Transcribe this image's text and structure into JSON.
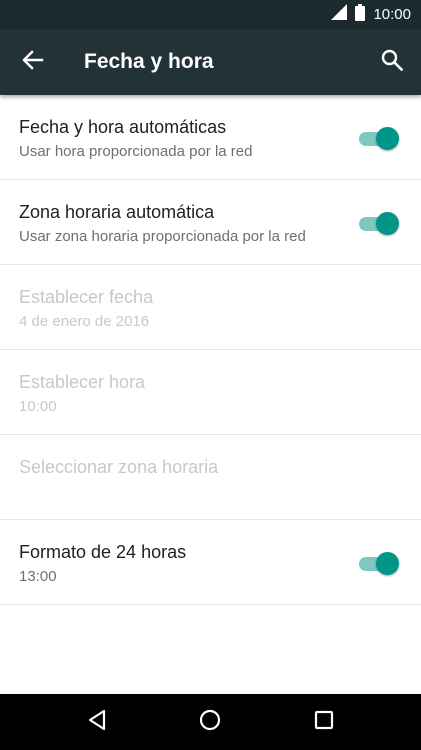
{
  "status_bar": {
    "time": "10:00",
    "icons": [
      "signal-icon",
      "battery-icon"
    ]
  },
  "app_bar": {
    "title": "Fecha y hora",
    "back_icon": "arrow-back-icon",
    "search_icon": "search-icon"
  },
  "settings": [
    {
      "title": "Fecha y hora automáticas",
      "subtitle": "Usar hora proporcionada por la red",
      "toggle": true,
      "enabled": true
    },
    {
      "title": "Zona horaria automática",
      "subtitle": "Usar zona horaria proporcionada por la red",
      "toggle": true,
      "enabled": true
    },
    {
      "title": "Establecer fecha",
      "subtitle": "4 de enero de 2016",
      "toggle": false,
      "enabled": false
    },
    {
      "title": "Establecer hora",
      "subtitle": "10:00",
      "toggle": false,
      "enabled": false
    },
    {
      "title": "Seleccionar zona horaria",
      "subtitle": "",
      "toggle": false,
      "enabled": false
    },
    {
      "title": "Formato de 24 horas",
      "subtitle": "13:00",
      "toggle": true,
      "enabled": true
    }
  ],
  "nav_bar": {
    "icons": [
      "nav-back-icon",
      "nav-home-icon",
      "nav-recents-icon"
    ]
  },
  "colors": {
    "status_bar": "#1a2a2e",
    "app_bar": "#233237",
    "accent": "#009688",
    "accent_track": "#7fc8bf",
    "disabled_text": "#c8c8c8"
  }
}
